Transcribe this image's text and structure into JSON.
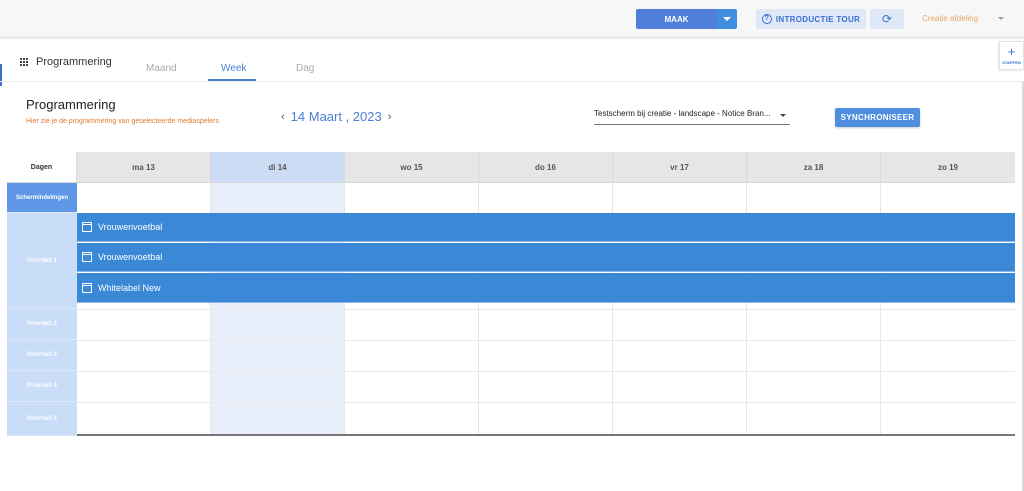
{
  "topbar": {
    "maak_label": "MAAK",
    "tour_label": "INTRODUCTIE TOUR",
    "tour_icon": "?",
    "sync_icon": "⟳",
    "org_label": "Creatie afdeling"
  },
  "stappen": {
    "plus": "+",
    "label": "STAPPEN"
  },
  "nav": {
    "title": "Programmering",
    "tabs": [
      {
        "label": "Maand"
      },
      {
        "label": "Week",
        "active": true
      },
      {
        "label": "Dag"
      }
    ]
  },
  "header": {
    "title": "Programmering",
    "subtitle": "Hier zie je de programmering van geselecteerde mediaspelers",
    "date_label": "14 Maart , 2023",
    "prev_arrow": "‹",
    "next_arrow": "›",
    "player_select_value": "Testscherm bij creatie - landscape - Notice Bran...",
    "sync_button_label": "SYNCHRONISEER"
  },
  "calendar": {
    "corner_label": "Dagen",
    "days": [
      "ma 13",
      "di 14",
      "wo 15",
      "do 16",
      "vr 17",
      "za 18",
      "zo 19"
    ],
    "today_index": 1,
    "rows": {
      "schermindelingen": "Schermindelingen",
      "prioriteit_1": "Prioriteit 1",
      "prioriteit_2": "Prioriteit 2",
      "prioriteit_3": "Prioriteit 3",
      "prioriteit_4": "Prioriteit 4",
      "prioriteit_5": "Prioriteit 5"
    },
    "events": [
      {
        "title": "Vrouwenvoetbal"
      },
      {
        "title": "Vrouwenvoetbal"
      },
      {
        "title": "Whitelabel New"
      }
    ]
  },
  "colors": {
    "accent": "#4f7fd8",
    "event": "#3a88d6",
    "subtitle": "#e07b2e",
    "org": "#e8a66a"
  }
}
